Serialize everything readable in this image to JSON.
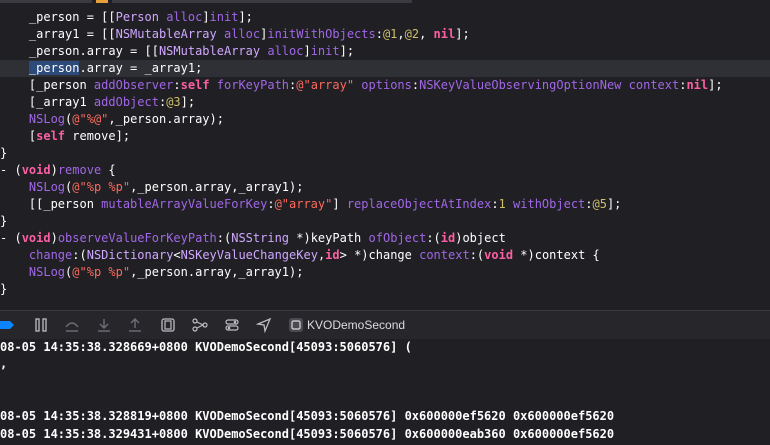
{
  "editor": {
    "lines": [
      [
        {
          "t": "    _person = [[",
          "c": "plain"
        },
        {
          "t": "Person",
          "c": "cls"
        },
        {
          "t": " ",
          "c": "plain"
        },
        {
          "t": "alloc",
          "c": "meth"
        },
        {
          "t": "]",
          "c": "plain"
        },
        {
          "t": "init",
          "c": "meth"
        },
        {
          "t": "];",
          "c": "plain"
        }
      ],
      [
        {
          "t": "    _array1 = [[",
          "c": "plain"
        },
        {
          "t": "NSMutableArray",
          "c": "cls"
        },
        {
          "t": " ",
          "c": "plain"
        },
        {
          "t": "alloc",
          "c": "meth"
        },
        {
          "t": "]",
          "c": "plain"
        },
        {
          "t": "initWithObjects",
          "c": "meth"
        },
        {
          "t": ":",
          "c": "plain"
        },
        {
          "t": "@1",
          "c": "num"
        },
        {
          "t": ",",
          "c": "plain"
        },
        {
          "t": "@2",
          "c": "num"
        },
        {
          "t": ", ",
          "c": "plain"
        },
        {
          "t": "nil",
          "c": "kw"
        },
        {
          "t": "];",
          "c": "plain"
        }
      ],
      [
        {
          "t": "    _person.",
          "c": "plain"
        },
        {
          "t": "array",
          "c": "plain"
        },
        {
          "t": " = [[",
          "c": "plain"
        },
        {
          "t": "NSMutableArray",
          "c": "cls"
        },
        {
          "t": " ",
          "c": "plain"
        },
        {
          "t": "alloc",
          "c": "meth"
        },
        {
          "t": "]",
          "c": "plain"
        },
        {
          "t": "init",
          "c": "meth"
        },
        {
          "t": "];",
          "c": "plain"
        }
      ],
      [
        {
          "t": "    ",
          "c": "plain"
        },
        {
          "t": "_person",
          "c": "sel"
        },
        {
          "t": ".array = _array1;",
          "c": "plain"
        }
      ],
      [
        {
          "t": "    [_person ",
          "c": "plain"
        },
        {
          "t": "addObserver",
          "c": "meth"
        },
        {
          "t": ":",
          "c": "plain"
        },
        {
          "t": "self",
          "c": "kw"
        },
        {
          "t": " ",
          "c": "plain"
        },
        {
          "t": "forKeyPath",
          "c": "meth"
        },
        {
          "t": ":",
          "c": "plain"
        },
        {
          "t": "@\"array\"",
          "c": "str"
        },
        {
          "t": " ",
          "c": "plain"
        },
        {
          "t": "options",
          "c": "meth"
        },
        {
          "t": ":",
          "c": "plain"
        },
        {
          "t": "NSKeyValueObservingOptionNew",
          "c": "meth"
        },
        {
          "t": " ",
          "c": "plain"
        },
        {
          "t": "context",
          "c": "meth"
        },
        {
          "t": ":",
          "c": "plain"
        },
        {
          "t": "nil",
          "c": "kw"
        },
        {
          "t": "];",
          "c": "plain"
        }
      ],
      [
        {
          "t": "    [_array1 ",
          "c": "plain"
        },
        {
          "t": "addObject",
          "c": "meth"
        },
        {
          "t": ":",
          "c": "plain"
        },
        {
          "t": "@3",
          "c": "num"
        },
        {
          "t": "];",
          "c": "plain"
        }
      ],
      [
        {
          "t": "    ",
          "c": "plain"
        },
        {
          "t": "NSLog",
          "c": "meth"
        },
        {
          "t": "(",
          "c": "plain"
        },
        {
          "t": "@\"%@\"",
          "c": "str"
        },
        {
          "t": ",_person.array);",
          "c": "plain"
        }
      ],
      [
        {
          "t": "    [",
          "c": "plain"
        },
        {
          "t": "self",
          "c": "kw"
        },
        {
          "t": " remove];",
          "c": "plain"
        }
      ],
      [
        {
          "t": "}",
          "c": "plain"
        }
      ],
      [
        {
          "t": "- (",
          "c": "plain"
        },
        {
          "t": "void",
          "c": "kw"
        },
        {
          "t": ")",
          "c": "plain"
        },
        {
          "t": "remove",
          "c": "meth"
        },
        {
          "t": " {",
          "c": "plain"
        }
      ],
      [
        {
          "t": "    ",
          "c": "plain"
        },
        {
          "t": "NSLog",
          "c": "meth"
        },
        {
          "t": "(",
          "c": "plain"
        },
        {
          "t": "@\"%p %p\"",
          "c": "str"
        },
        {
          "t": ",_person.array,_array1);",
          "c": "plain"
        }
      ],
      [
        {
          "t": "    [[_person ",
          "c": "plain"
        },
        {
          "t": "mutableArrayValueForKey",
          "c": "meth"
        },
        {
          "t": ":",
          "c": "plain"
        },
        {
          "t": "@\"array\"",
          "c": "str"
        },
        {
          "t": "] ",
          "c": "plain"
        },
        {
          "t": "replaceObjectAtIndex",
          "c": "meth"
        },
        {
          "t": ":",
          "c": "plain"
        },
        {
          "t": "1",
          "c": "num"
        },
        {
          "t": " ",
          "c": "plain"
        },
        {
          "t": "withObject",
          "c": "meth"
        },
        {
          "t": ":",
          "c": "plain"
        },
        {
          "t": "@5",
          "c": "num"
        },
        {
          "t": "];",
          "c": "plain"
        }
      ],
      [
        {
          "t": "}",
          "c": "plain"
        }
      ],
      [
        {
          "t": "- (",
          "c": "plain"
        },
        {
          "t": "void",
          "c": "kw"
        },
        {
          "t": ")",
          "c": "plain"
        },
        {
          "t": "observeValueForKeyPath",
          "c": "meth"
        },
        {
          "t": ":(",
          "c": "plain"
        },
        {
          "t": "NSString",
          "c": "cls"
        },
        {
          "t": " *)keyPath ",
          "c": "plain"
        },
        {
          "t": "ofObject",
          "c": "meth"
        },
        {
          "t": ":(",
          "c": "plain"
        },
        {
          "t": "id",
          "c": "kw"
        },
        {
          "t": ")object",
          "c": "plain"
        }
      ],
      [
        {
          "t": "    ",
          "c": "plain"
        },
        {
          "t": "change",
          "c": "meth"
        },
        {
          "t": ":(",
          "c": "plain"
        },
        {
          "t": "NSDictionary",
          "c": "cls"
        },
        {
          "t": "<",
          "c": "plain"
        },
        {
          "t": "NSKeyValueChangeKey",
          "c": "cls"
        },
        {
          "t": ",",
          "c": "plain"
        },
        {
          "t": "id",
          "c": "kw"
        },
        {
          "t": "> *)change ",
          "c": "plain"
        },
        {
          "t": "context",
          "c": "meth"
        },
        {
          "t": ":(",
          "c": "plain"
        },
        {
          "t": "void",
          "c": "kw"
        },
        {
          "t": " *)context {",
          "c": "plain"
        }
      ],
      [
        {
          "t": "    ",
          "c": "plain"
        },
        {
          "t": "NSLog",
          "c": "meth"
        },
        {
          "t": "(",
          "c": "plain"
        },
        {
          "t": "@\"%p %p\"",
          "c": "str"
        },
        {
          "t": ",_person.array,_array1);",
          "c": "plain"
        }
      ],
      [
        {
          "t": "}",
          "c": "plain"
        }
      ]
    ],
    "highlighted_line": 3
  },
  "debugbar": {
    "scheme_label": "KVODemoSecond",
    "icons": [
      "breakpoints-toggle-icon",
      "pause-icon",
      "step-over-icon",
      "step-into-icon",
      "step-out-icon",
      "view-hierarchy-icon",
      "memory-graph-icon",
      "environment-overrides-icon",
      "simulate-location-icon",
      "app-icon"
    ]
  },
  "console": {
    "lines": [
      "08-05 14:35:38.328669+0800 KVODemoSecond[45093:5060576] (",
      ",",
      "",
      "",
      "08-05 14:35:38.328819+0800 KVODemoSecond[45093:5060576] 0x600000ef5620 0x600000ef5620",
      "08-05 14:35:38.329431+0800 KVODemoSecond[45093:5060576] 0x600000eab360 0x600000ef5620"
    ]
  },
  "colors": {
    "background": "#1f1f24",
    "keyword": "#fc5fa3",
    "string": "#fc6a5d",
    "number": "#d0bf69",
    "method": "#a167e6",
    "class": "#d0a8ff",
    "accent": "#0a84ff"
  }
}
